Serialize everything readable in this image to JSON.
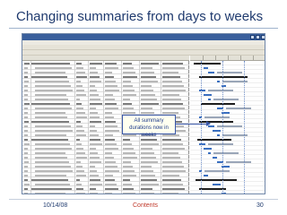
{
  "slide": {
    "title": "Changing summaries from days to weeks",
    "callout": "All summary durations now in weeks",
    "footer": {
      "date": "10/14/08",
      "link": "Contents",
      "page": "30"
    }
  },
  "colors": {
    "title": "#1f3a6e",
    "accent": "#3a58a8",
    "link": "#c0392b",
    "gantt_bar": "#3a6fc0",
    "summary_bar": "#1e1e1e"
  }
}
